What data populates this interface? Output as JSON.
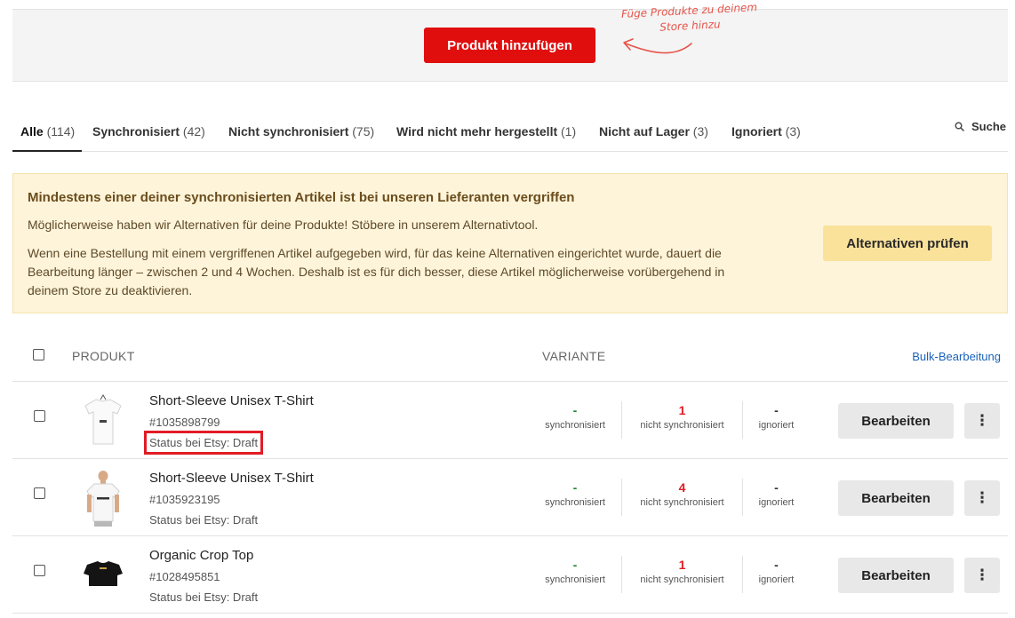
{
  "header": {
    "add_button": "Produkt hinzufügen",
    "hint_line1": "Füge Produkte zu deinem",
    "hint_line2": "Store hinzu"
  },
  "tabs": [
    {
      "label": "Alle",
      "count": "(114)",
      "active": true
    },
    {
      "label": "Synchronisiert",
      "count": "(42)"
    },
    {
      "label": "Nicht synchronisiert",
      "count": "(75)"
    },
    {
      "label": "Wird nicht mehr hergestellt",
      "count": "(1)"
    },
    {
      "label": "Nicht auf Lager",
      "count": "(3)"
    },
    {
      "label": "Ignoriert",
      "count": "(3)"
    }
  ],
  "search": {
    "label": "Suche",
    "icon": "search-icon"
  },
  "warning": {
    "title": "Mindestens einer deiner synchronisierten Artikel ist bei unseren Lieferanten vergriffen",
    "paragraph1": "Möglicherweise haben wir Alternativen für deine Produkte! Stöbere in unserem Alternativtool.",
    "paragraph2": "Wenn eine Bestellung mit einem vergriffenen Artikel aufgegeben wird, für das keine Alternativen eingerichtet wurde, dauert die Bearbeitung länger – zwischen 2 und 4 Wochen. Deshalb ist es für dich besser, diese Artikel möglicherweise vorübergehend in deinem Store zu deaktivieren.",
    "button": "Alternativen prüfen"
  },
  "table": {
    "col_product": "PRODUKT",
    "col_variant": "VARIANTE",
    "bulk_edit": "Bulk-Bearbeitung",
    "label_synced": "synchronisiert",
    "label_not_synced": "nicht synchronisiert",
    "label_ignored": "ignoriert",
    "edit_button": "Bearbeiten",
    "more_button": "⋮",
    "rows": [
      {
        "name": "Short-Sleeve Unisex T-Shirt",
        "id": "#1035898799",
        "status": "Status bei Etsy: Draft",
        "synced": "-",
        "not_synced": "1",
        "ignored": "-",
        "highlighted": true
      },
      {
        "name": "Short-Sleeve Unisex T-Shirt",
        "id": "#1035923195",
        "status": "Status bei Etsy: Draft",
        "synced": "-",
        "not_synced": "4",
        "ignored": "-"
      },
      {
        "name": "Organic Crop Top",
        "id": "#1028495851",
        "status": "Status bei Etsy: Draft",
        "synced": "-",
        "not_synced": "1",
        "ignored": "-"
      }
    ]
  },
  "colors": {
    "primary": "#e10e0e",
    "warning_bg": "#fdf4da",
    "warning_button": "#fbe29a",
    "link": "#1a62b8",
    "synced": "#1c8a2e",
    "not_synced": "#e11c26"
  }
}
